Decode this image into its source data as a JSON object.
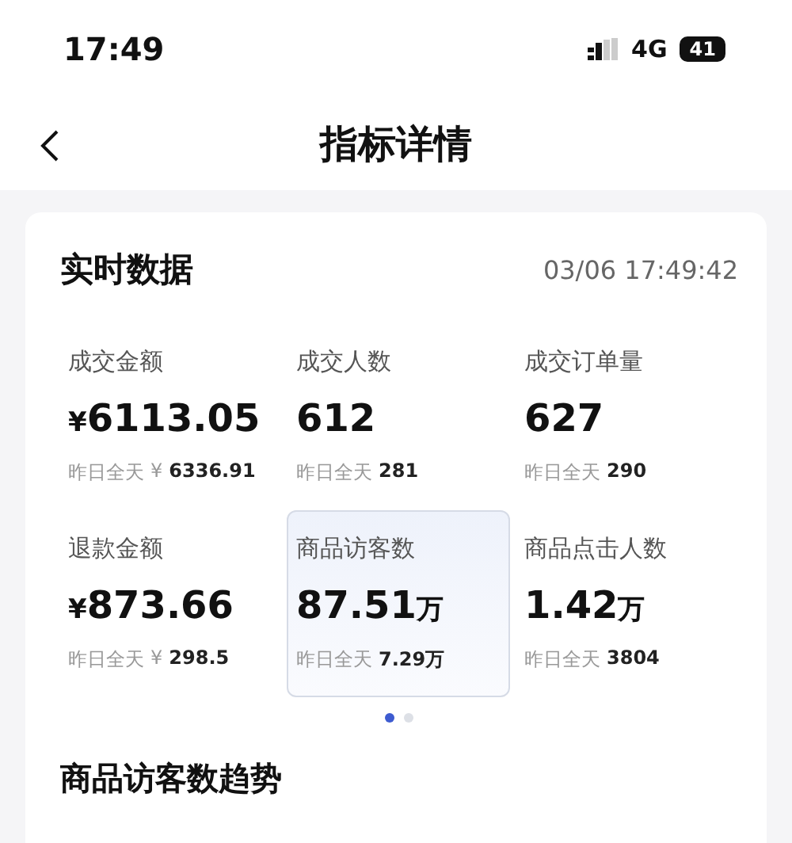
{
  "status_bar": {
    "time": "17:49",
    "network": "4G",
    "battery": "41"
  },
  "nav": {
    "title": "指标详情"
  },
  "realtime": {
    "title": "实时数据",
    "timestamp": "03/06 17:49:42",
    "metrics": [
      {
        "label": "成交金额",
        "prefix": "¥",
        "value": "6113.05",
        "prev_label": "昨日全天",
        "prev_prefix": "¥",
        "prev_value": "6336.91",
        "selected": false
      },
      {
        "label": "成交人数",
        "value": "612",
        "prev_label": "昨日全天",
        "prev_value": "281",
        "selected": false
      },
      {
        "label": "成交订单量",
        "value": "627",
        "prev_label": "昨日全天",
        "prev_value": "290",
        "selected": false
      },
      {
        "label": "退款金额",
        "prefix": "¥",
        "value": "873.66",
        "prev_label": "昨日全天",
        "prev_prefix": "¥",
        "prev_value": "298.5",
        "selected": false
      },
      {
        "label": "商品访客数",
        "value": "87.51",
        "unit": "万",
        "prev_label": "昨日全天",
        "prev_value": "7.29万",
        "selected": true
      },
      {
        "label": "商品点击人数",
        "value": "1.42",
        "unit": "万",
        "prev_label": "昨日全天",
        "prev_value": "3804",
        "selected": false
      }
    ],
    "pages": [
      {
        "selected": true
      },
      {
        "selected": false
      }
    ]
  },
  "trend": {
    "title": "商品访客数趋势"
  }
}
